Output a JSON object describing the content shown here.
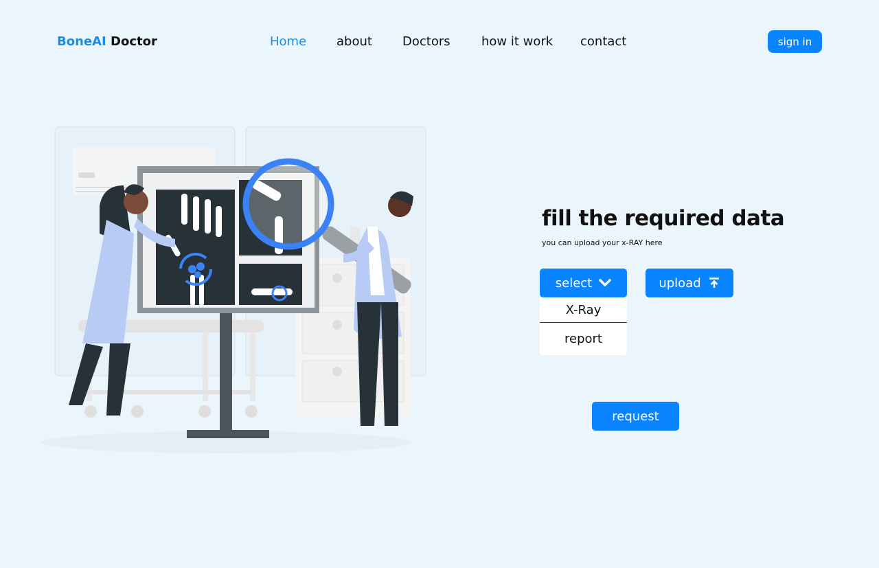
{
  "brand": {
    "part1": "BoneAI",
    "part2": "Doctor"
  },
  "nav": {
    "home": "Home",
    "about": "about",
    "doctors": "Doctors",
    "how": "how it work",
    "contact": "contact"
  },
  "header": {
    "signin": "sign in"
  },
  "main": {
    "title": "fill the required data",
    "subtitle": "you can upload your x-RAY here",
    "select_label": "select",
    "upload_label": "upload",
    "options": [
      "X-Ray",
      "report"
    ],
    "request_label": "request"
  },
  "icons": {
    "select": "chevron-down-icon",
    "upload": "upload-icon"
  },
  "colors": {
    "accent": "#0a84ff",
    "background": "#ebf5fc",
    "brand": "#1a8ee6"
  }
}
